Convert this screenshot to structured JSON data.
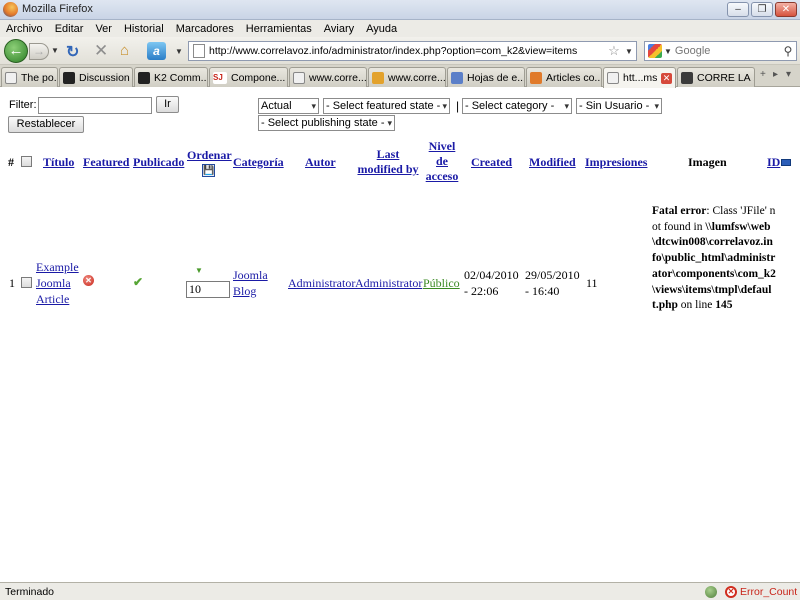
{
  "window": {
    "title": "Mozilla Firefox",
    "controls": [
      "minimize-icon",
      "restore-icon",
      "close-icon"
    ]
  },
  "menu": {
    "items": [
      "Archivo",
      "Editar",
      "Ver",
      "Historial",
      "Marcadores",
      "Herramientas",
      "Aviary",
      "Ayuda"
    ]
  },
  "navbar": {
    "url": "http://www.correlavoz.info/administrator/index.php?option=com_k2&view=items",
    "search_placeholder": "Google"
  },
  "tabs": [
    {
      "label": "The po...",
      "icon": "page-icon",
      "icon_color": "#f0f0f0"
    },
    {
      "label": "Discussion ...",
      "icon": "joomla-icon",
      "icon_color": "#222222"
    },
    {
      "label": "K2 Comm...",
      "icon": "joomla-icon",
      "icon_color": "#222222"
    },
    {
      "label": "Compone...",
      "icon": "sj-icon",
      "icon_color": "#c8251a"
    },
    {
      "label": "www.corre...",
      "icon": "page-icon",
      "icon_color": "#f0f0f0"
    },
    {
      "label": "www.corre...",
      "icon": "pma-icon",
      "icon_color": "#e3a22c"
    },
    {
      "label": "Hojas de e...",
      "icon": "st-icon",
      "icon_color": "#5b7fc8"
    },
    {
      "label": "Articles co...",
      "icon": "joomla-icon",
      "icon_color": "#e07a2a"
    },
    {
      "label": "htt...ms",
      "icon": "page-icon",
      "icon_color": "#f0f0f0",
      "active": true
    },
    {
      "label": "CORRE LA ...",
      "icon": "joomla-icon",
      "icon_color": "#3b3b3b"
    }
  ],
  "toolbar": {
    "filter_label": "Filter:",
    "go_label": "Ir",
    "reset_label": "Restablecer",
    "select_current": "Actual",
    "select_featured": "- Select featured state -",
    "separator": "|",
    "select_category": "- Select category -",
    "select_user": "- Sin Usuario -",
    "select_publishing": "- Select publishing state -"
  },
  "table": {
    "headers": {
      "num": "#",
      "title": "Título",
      "featured": "Featured",
      "published": "Publicado",
      "order": "Ordenar",
      "category": "Categoría",
      "author": "Autor",
      "modified_by": "Last modified by",
      "access": "Nivel de acceso",
      "created": "Created",
      "modified": "Modified",
      "hits": "Impresiones",
      "image": "Imagen",
      "id": "ID"
    },
    "rows": [
      {
        "num": "1",
        "title": "Example Joomla Article",
        "featured": false,
        "published": true,
        "order": "10",
        "category": "Joomla Blog",
        "author": "Administrator",
        "modified_by": "Administrator",
        "access": "Público",
        "created": "02/04/2010 - 22:06",
        "modified": "29/05/2010 - 16:40",
        "hits": "11",
        "error": {
          "label": "Fatal error",
          "message": ": Class 'JFile' not found in ",
          "path": "\\\\lumfsw\\web\\dtcwin008\\correlavoz.info\\public_html\\administrator\\components\\com_k2\\views\\items\\tmpl\\default.php",
          "on_line": " on line ",
          "line": "145"
        }
      }
    ]
  },
  "status": {
    "text": "Terminado",
    "error_count": "Error_Count"
  },
  "colors": {
    "link": "#1a1aa6",
    "link_green": "#3a8a23",
    "error_red": "#c8251a",
    "published_green": "#56a534"
  }
}
